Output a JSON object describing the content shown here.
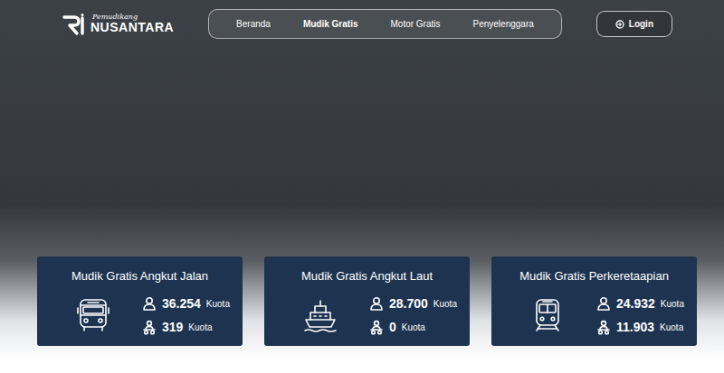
{
  "logo": {
    "script": "Pemudikang",
    "title": "NUSANTARA"
  },
  "nav": [
    {
      "label": "Beranda",
      "selected": false
    },
    {
      "label": "Mudik Gratis",
      "selected": true
    },
    {
      "label": "Motor Gratis",
      "selected": false
    },
    {
      "label": "Penyelenggara",
      "selected": false
    }
  ],
  "login": {
    "label": "Login"
  },
  "cards": [
    {
      "title": "Mudik Gratis Angkut Jalan",
      "kind": "bus",
      "rows": [
        {
          "kind": "penumpang",
          "value": "36.254",
          "unit": "Kuota"
        },
        {
          "kind": "motor",
          "value": "319",
          "unit": "Kuota"
        }
      ]
    },
    {
      "title": "Mudik Gratis Angkut Laut",
      "kind": "ship",
      "rows": [
        {
          "kind": "penumpang",
          "value": "28.700",
          "unit": "Kuota"
        },
        {
          "kind": "motor",
          "value": "0",
          "unit": "Kuota"
        }
      ]
    },
    {
      "title": "Mudik Gratis Perkeretaapian",
      "kind": "train",
      "rows": [
        {
          "kind": "penumpang",
          "value": "24.932",
          "unit": "Kuota"
        },
        {
          "kind": "motor",
          "value": "11.903",
          "unit": "Kuota"
        }
      ]
    }
  ]
}
